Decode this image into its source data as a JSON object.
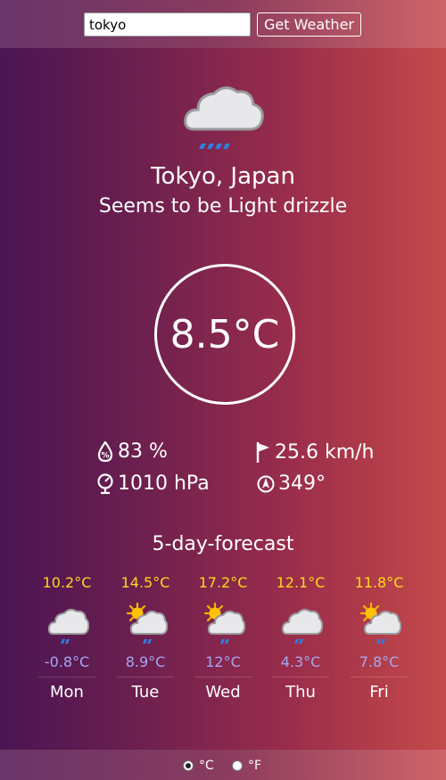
{
  "search": {
    "value": "tokyo",
    "button_label": "Get Weather"
  },
  "current": {
    "icon": "cloud-drizzle-icon",
    "location": "Tokyo, Japan",
    "description": "Seems to be Light drizzle",
    "temperature": "8.5°C",
    "humidity": "83 %",
    "wind_speed": "25.6 km/h",
    "pressure": "1010 hPa",
    "wind_direction": "349°"
  },
  "forecast": {
    "title": "5-day-forecast",
    "days": [
      {
        "high": "10.2°C",
        "low": "-0.8°C",
        "day": "Mon",
        "icon": "cloud-drizzle-icon"
      },
      {
        "high": "14.5°C",
        "low": "8.9°C",
        "day": "Tue",
        "icon": "sun-cloud-drizzle-icon"
      },
      {
        "high": "17.2°C",
        "low": "12°C",
        "day": "Wed",
        "icon": "sun-cloud-drizzle-icon"
      },
      {
        "high": "12.1°C",
        "low": "4.3°C",
        "day": "Thu",
        "icon": "cloud-drizzle-icon"
      },
      {
        "high": "11.8°C",
        "low": "7.8°C",
        "day": "Fri",
        "icon": "sun-cloud-drizzle-icon"
      }
    ]
  },
  "units": {
    "celsius_label": "°C",
    "fahrenheit_label": "°F",
    "selected": "celsius"
  },
  "colors": {
    "high_temp": "#ffd81c",
    "low_temp": "#a6a7f2",
    "rain": "#2f7fe0"
  }
}
